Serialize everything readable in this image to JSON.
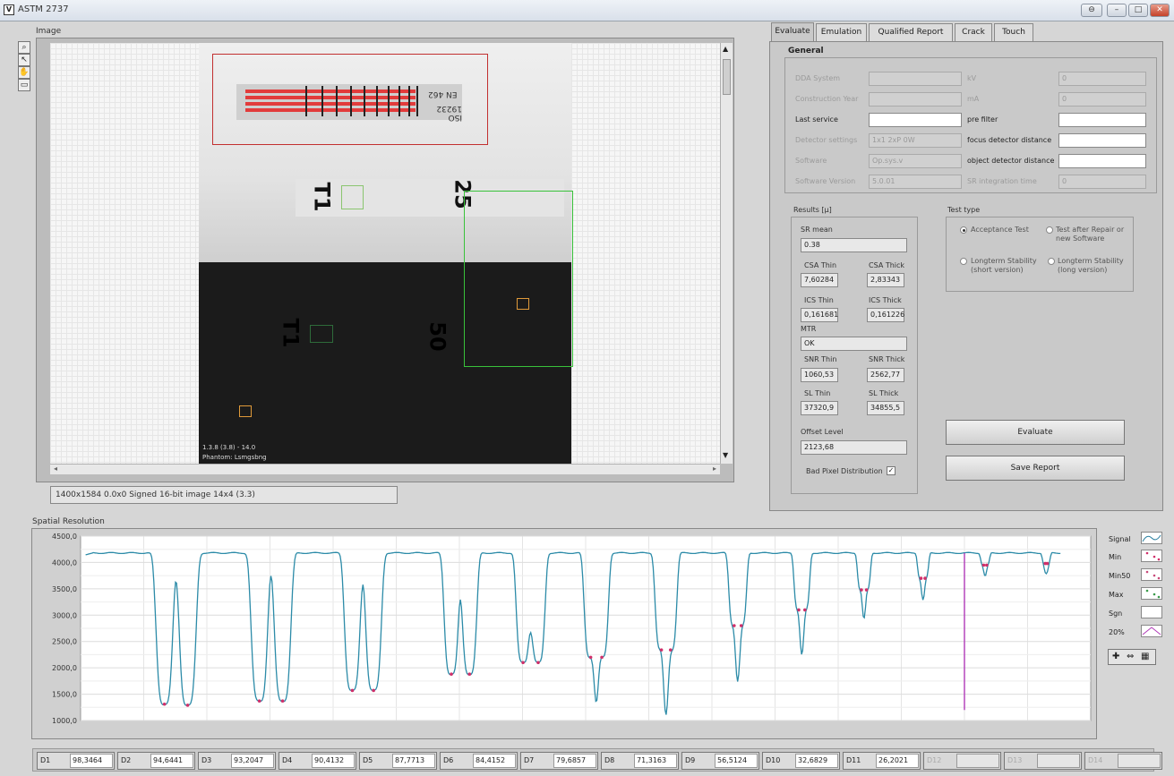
{
  "window": {
    "title": "ASTM 2737",
    "buttons": [
      "⊖",
      "–",
      "□",
      "✕"
    ]
  },
  "image_panel": {
    "label": "Image",
    "tools": [
      "⌕",
      "↖",
      "✋",
      "▭"
    ],
    "status_text": "1400x1584 0.0x0 Signed 16-bit image 14x4 (3.3)",
    "phantom_top_labels": [
      "T1",
      "25"
    ],
    "phantom_bottom_labels": [
      "T1",
      "50"
    ],
    "iqi_text": [
      "EN 462",
      "ISO 19232"
    ],
    "overlay_text": [
      "1.3.8 (3.8) - 14.0",
      "Phantom: Lsmgsbng"
    ]
  },
  "tabs": [
    "Evaluate",
    "Emulation",
    "Qualified Report",
    "Crack",
    "Touch"
  ],
  "general": {
    "heading": "General",
    "left_fields": [
      {
        "label": "DDA System",
        "value": "",
        "enabled": false
      },
      {
        "label": "Construction Year",
        "value": "",
        "enabled": false
      },
      {
        "label": "Last service",
        "value": "",
        "enabled": true
      },
      {
        "label": "Detector settings",
        "value": "1x1 2xP 0W",
        "enabled": false
      },
      {
        "label": "Software",
        "value": "Op.sys.v",
        "enabled": false
      },
      {
        "label": "Software Version",
        "value": "5.0.01",
        "enabled": false
      }
    ],
    "right_fields": [
      {
        "label": "kV",
        "value": "0",
        "enabled": false
      },
      {
        "label": "mA",
        "value": "0",
        "enabled": false
      },
      {
        "label": "pre filter",
        "value": "",
        "enabled": true
      },
      {
        "label": "focus detector distance",
        "value": "",
        "enabled": true
      },
      {
        "label": "object detector distance",
        "value": "",
        "enabled": true
      },
      {
        "label": "SR integration time",
        "value": "0",
        "enabled": false
      }
    ]
  },
  "results": {
    "heading": "Results [µ]",
    "sr_label": "SR mean",
    "sr_value": "0.38",
    "csa_thin_label": "CSA Thin",
    "csa_thin_value": "7,60284",
    "csa_thick_label": "CSA Thick",
    "csa_thick_value": "2,83343",
    "ics_thin_label": "ICS Thin",
    "ics_thin_value": "0,161681",
    "ics_thick_label": "ICS Thick",
    "ics_thick_value": "0,161226",
    "mtr_label": "MTR",
    "mtr_value": "OK",
    "snr_thin_label": "SNR Thin",
    "snr_thin_value": "1060,53",
    "snr_thick_label": "SNR Thick",
    "snr_thick_value": "2562,77",
    "sl_thin_label": "SL Thin",
    "sl_thin_value": "37320,9",
    "sl_thick_label": "SL Thick",
    "sl_thick_value": "34855,5",
    "offset_label": "Offset Level",
    "offset_value": "2123,68",
    "bad_pixel_label": "Bad Pixel Distribution"
  },
  "test_type": {
    "heading": "Test type",
    "options": [
      {
        "label": "Acceptance Test",
        "selected": true
      },
      {
        "label": "Test after Repair or new Software",
        "selected": false
      },
      {
        "label": "Longterm Stability (short version)",
        "selected": false
      },
      {
        "label": "Longterm Stability (long version)",
        "selected": false
      }
    ]
  },
  "actions": {
    "evaluate": "Evaluate",
    "save_report": "Save Report"
  },
  "spatial": {
    "label": "Spatial Resolution",
    "legend": [
      "Signal",
      "Min",
      "Min50",
      "Max",
      "Sgn",
      "20%"
    ],
    "zoom_tools": [
      "✚",
      "⇔",
      "▦"
    ]
  },
  "chart_data": {
    "type": "line",
    "ylim": [
      1000,
      4500
    ],
    "y_ticks": [
      "4500,0",
      "4000,0",
      "3500,0",
      "3000,0",
      "2500,0",
      "2000,0",
      "1500,0",
      "1000,0"
    ],
    "baseline": 4180,
    "dips": [
      {
        "pos": 0.083,
        "depth": 1310
      },
      {
        "pos": 0.106,
        "depth": 1290
      },
      {
        "pos": 0.177,
        "depth": 1370
      },
      {
        "pos": 0.2,
        "depth": 1370
      },
      {
        "pos": 0.269,
        "depth": 1570
      },
      {
        "pos": 0.29,
        "depth": 1570
      },
      {
        "pos": 0.367,
        "depth": 1880
      },
      {
        "pos": 0.385,
        "depth": 1880
      },
      {
        "pos": 0.438,
        "depth": 2100
      },
      {
        "pos": 0.453,
        "depth": 2100
      },
      {
        "pos": 0.505,
        "depth": 2200
      },
      {
        "pos": 0.516,
        "depth": 2200
      },
      {
        "pos": 0.575,
        "depth": 2340
      },
      {
        "pos": 0.584,
        "depth": 2340
      },
      {
        "pos": 0.647,
        "depth": 2800
      },
      {
        "pos": 0.654,
        "depth": 2800
      },
      {
        "pos": 0.711,
        "depth": 3100
      },
      {
        "pos": 0.717,
        "depth": 3100
      },
      {
        "pos": 0.773,
        "depth": 3480
      },
      {
        "pos": 0.778,
        "depth": 3480
      },
      {
        "pos": 0.832,
        "depth": 3700
      },
      {
        "pos": 0.836,
        "depth": 3700
      },
      {
        "pos": 0.894,
        "depth": 3950
      },
      {
        "pos": 0.897,
        "depth": 3950
      },
      {
        "pos": 0.955,
        "depth": 3980
      },
      {
        "pos": 0.957,
        "depth": 3980
      }
    ],
    "marker_pos": 0.875,
    "marker_bottom": 1200
  },
  "bottom_cells": [
    {
      "name": "D1",
      "value": "98,3464"
    },
    {
      "name": "D2",
      "value": "94,6441"
    },
    {
      "name": "D3",
      "value": "93,2047"
    },
    {
      "name": "D4",
      "value": "90,4132"
    },
    {
      "name": "D5",
      "value": "87,7713"
    },
    {
      "name": "D6",
      "value": "84,4152"
    },
    {
      "name": "D7",
      "value": "79,6857"
    },
    {
      "name": "D8",
      "value": "71,3163"
    },
    {
      "name": "D9",
      "value": "56,5124"
    },
    {
      "name": "D10",
      "value": "32,6829"
    },
    {
      "name": "D11",
      "value": "26,2021"
    },
    {
      "name": "D12",
      "value": ""
    },
    {
      "name": "D13",
      "value": ""
    },
    {
      "name": "D14",
      "value": ""
    }
  ]
}
